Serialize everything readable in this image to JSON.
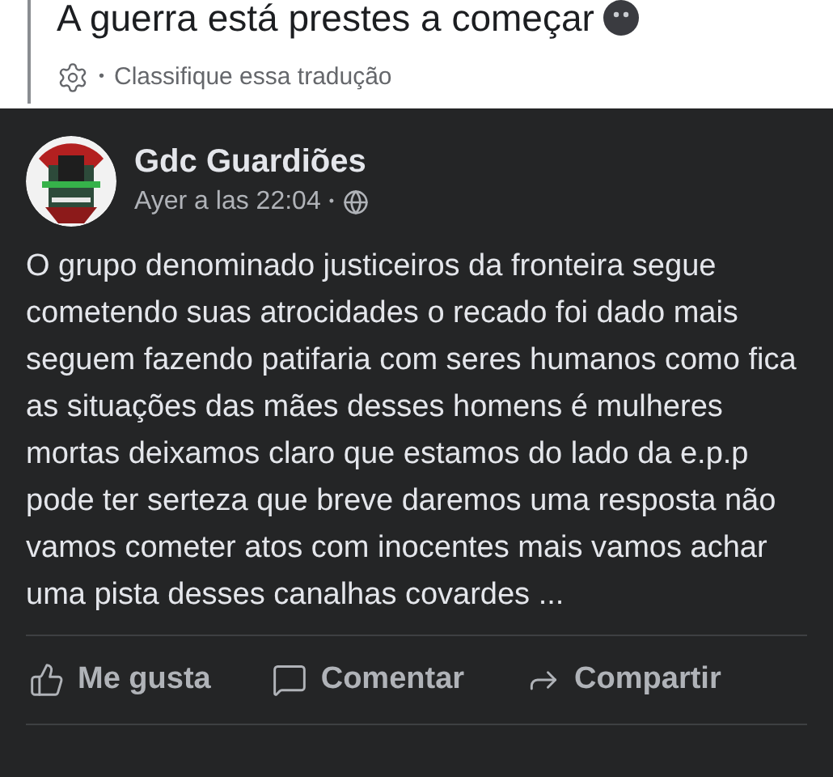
{
  "translation": {
    "text": "A guerra está prestes a começar",
    "rate_link": "Classifique essa tradução",
    "separator": "•"
  },
  "post": {
    "author": "Gdc Guardiões",
    "time": "Ayer a las 22:04",
    "time_separator": "•",
    "body": "O grupo denominado justiceiros da fronteira segue cometendo suas atrocidades o recado foi dado mais seguem fazendo patifaria com seres humanos como fica as situações das mães desses homens é mulheres mortas deixamos claro que estamos do lado da e.p.p pode ter serteza que breve daremos uma resposta não vamos cometer atos com inocentes mais vamos achar uma pista desses canalhas covardes ...",
    "actions": [
      {
        "kind": "like",
        "label": "Me gusta"
      },
      {
        "kind": "comment",
        "label": "Comentar"
      },
      {
        "kind": "share",
        "label": "Compartir"
      }
    ]
  }
}
